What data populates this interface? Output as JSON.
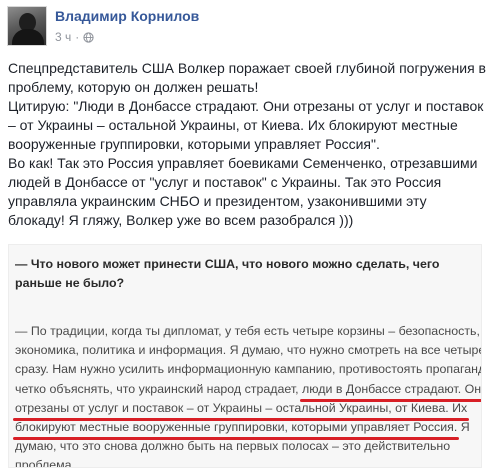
{
  "post": {
    "author": "Владимир Корнилов",
    "time": "3 ч",
    "separator": "·",
    "visibility_icon": "globe-icon",
    "paragraphs": [
      "Спецпредставитель США Волкер поражает своей глубиной погружения в проблему, которую он должен решать!",
      "Цитирую: \"Люди в Донбассе страдают. Они отрезаны от услуг и поставок – от Украины – остальной Украины, от Киева. Их блокируют местные вооруженные группировки, которыми управляет Россия\".",
      "Во как! Так это Россия управляет боевиками Семенченко, отрезавшими людей в Донбассе от \"услуг и поставок\" с Украины. Так это Россия управляла украинским СНБО и президентом, узаконившими эту блокаду! Я гляжу, Волкер уже во всем разобрался )))"
    ]
  },
  "quote": {
    "question": "— Что нового может принести США, что нового можно сделать, чего раньше не было?",
    "answer_lines": [
      {
        "text": "— По традиции, когда ты дипломат, у тебя есть четыре корзины – безопасность,",
        "hl": ""
      },
      {
        "text": "экономика, политика и информация. Я думаю, что нужно смотреть на все четыре",
        "hl": ""
      },
      {
        "text": "сразу. Нам нужно усилить информационную кампанию, противостоять пропаганде,",
        "hl": ""
      },
      {
        "text": "четко объяснять, что украинский народ страдает, ",
        "hl": "люди в Донбассе страдают. Они"
      },
      {
        "text": "",
        "hl": "отрезаны от услуг и поставок – от Украины – остальной Украины, от Киева. Их"
      },
      {
        "text": "",
        "hl": "блокируют местные вооруженные группировки, которыми управляет Россия.",
        "tail": " Я"
      },
      {
        "text": "думаю, что это снова должно быть на первых полосах – это действительно",
        "hl": ""
      },
      {
        "text": "проблема.",
        "hl": ""
      }
    ]
  },
  "colors": {
    "author_link": "#365899",
    "meta_text": "#90949c",
    "highlight_underline": "#d81f26"
  }
}
